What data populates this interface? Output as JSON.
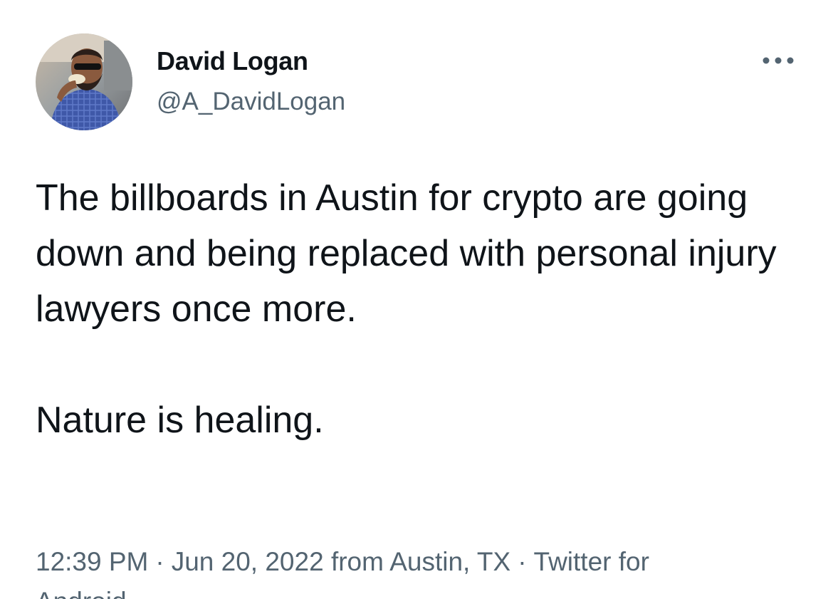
{
  "author": {
    "display_name": "David Logan",
    "handle": "@A_DavidLogan"
  },
  "more_icon": "more-horizontal-icon",
  "tweet": {
    "text_paragraph_1": "The billboards in Austin for crypto are going down and being replaced with personal injury lawyers once more.",
    "text_paragraph_2": "Nature is healing."
  },
  "meta": {
    "time": "12:39 PM",
    "separator": "·",
    "date": "Jun 20, 2022",
    "location": "from Austin, TX",
    "source": "Twitter for",
    "source_continued": "Android"
  },
  "colors": {
    "text": "#0f1419",
    "secondary": "#536471",
    "background": "#ffffff"
  }
}
